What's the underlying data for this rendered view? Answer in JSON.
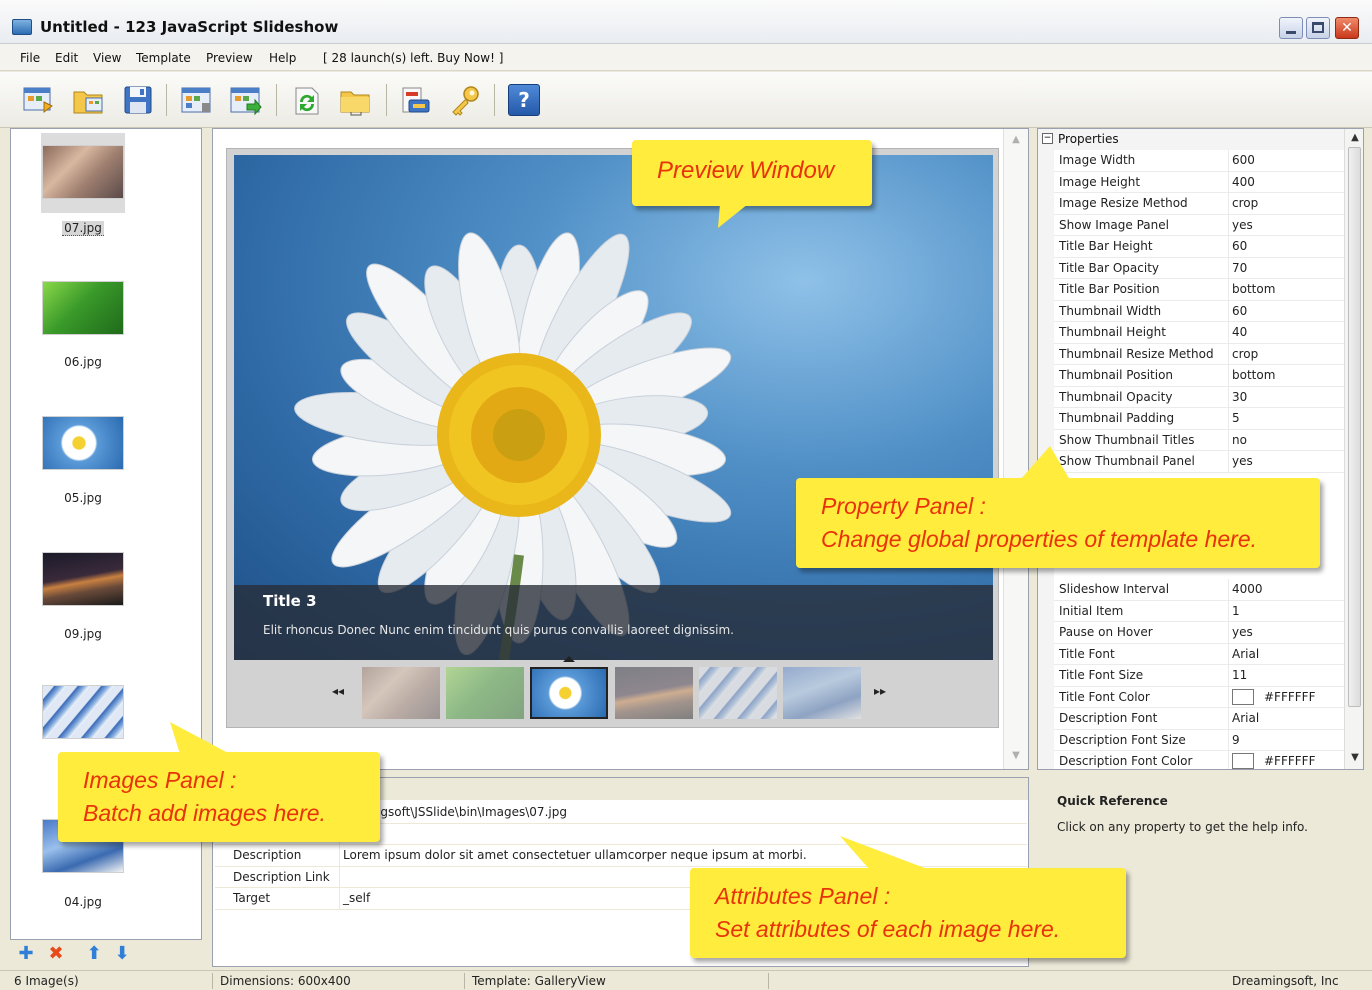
{
  "window": {
    "title": "Untitled - 123 JavaScript Slideshow",
    "minimize": "_",
    "maximize": "□",
    "close": "✕"
  },
  "menu": {
    "items": [
      "File",
      "Edit",
      "View",
      "Template",
      "Preview",
      "Help"
    ],
    "notice": "[ 28 launch(s) left. Buy Now! ]"
  },
  "toolbar": {
    "buttons": [
      "new-icon",
      "open-icon",
      "save-icon",
      "template-icon",
      "export-icon",
      "refresh-icon",
      "folder-icon",
      "publish-icon",
      "key-icon",
      "help-icon"
    ],
    "help_label": "?"
  },
  "images": {
    "items": [
      {
        "file": "07.jpg",
        "selected": true
      },
      {
        "file": "06.jpg",
        "selected": false
      },
      {
        "file": "05.jpg",
        "selected": false
      },
      {
        "file": "09.jpg",
        "selected": false
      },
      {
        "file": "04.jpg",
        "selected": false
      }
    ],
    "tools": [
      "add-icon",
      "delete-icon",
      "move-up-icon",
      "move-down-icon"
    ]
  },
  "preview": {
    "slide_title": "Title 3",
    "slide_description": "Elit rhoncus Donec Nunc enim tincidunt quis purus convallis laoreet dignissim.",
    "prev_label": "◂◂",
    "next_label": "▸▸"
  },
  "attributes": {
    "rows": [
      {
        "name": "",
        "value": "eamingsoft\\JSSlide\\bin\\Images\\07.jpg"
      },
      {
        "name": "",
        "value": ""
      },
      {
        "name": "Description",
        "value": "Lorem ipsum dolor sit amet consectetuer ullamcorper neque ipsum at morbi."
      },
      {
        "name": "Description Link",
        "value": ""
      },
      {
        "name": "Target",
        "value": "_self"
      }
    ]
  },
  "properties": {
    "header": "Properties",
    "rows": [
      {
        "name": "Image Width",
        "value": "600"
      },
      {
        "name": "Image Height",
        "value": "400"
      },
      {
        "name": "Image Resize Method",
        "value": "crop"
      },
      {
        "name": "Show Image Panel",
        "value": "yes"
      },
      {
        "name": "Title Bar Height",
        "value": "60"
      },
      {
        "name": "Title Bar Opacity",
        "value": "70"
      },
      {
        "name": "Title Bar Position",
        "value": "bottom"
      },
      {
        "name": "Thumbnail Width",
        "value": "60"
      },
      {
        "name": "Thumbnail Height",
        "value": "40"
      },
      {
        "name": "Thumbnail Resize Method",
        "value": "crop"
      },
      {
        "name": "Thumbnail Position",
        "value": "bottom"
      },
      {
        "name": "Thumbnail Opacity",
        "value": "30"
      },
      {
        "name": "Thumbnail Padding",
        "value": "5"
      },
      {
        "name": "Show Thumbnail Titles",
        "value": "no"
      },
      {
        "name": "Show Thumbnail Panel",
        "value": "yes"
      }
    ],
    "rows_lower": [
      {
        "name": "Slideshow Interval",
        "value": "4000"
      },
      {
        "name": "Initial Item",
        "value": "1"
      },
      {
        "name": "Pause on Hover",
        "value": "yes"
      },
      {
        "name": "Title Font",
        "value": "Arial"
      },
      {
        "name": "Title Font Size",
        "value": "11"
      },
      {
        "name": "Title Font Color",
        "value": "#FFFFFF",
        "swatch": "#FFFFFF"
      },
      {
        "name": "Description Font",
        "value": "Arial"
      },
      {
        "name": "Description Font Size",
        "value": "9"
      },
      {
        "name": "Description Font Color",
        "value": "#FFFFFF",
        "swatch": "#FFFFFF"
      }
    ]
  },
  "quick_reference": {
    "title": "Quick Reference",
    "body": "Click on any property to get the help info."
  },
  "status": {
    "count": "6 Image(s)",
    "dimensions": "Dimensions: 600x400",
    "template": "Template: GalleryView",
    "company": "Dreamingsoft, Inc"
  },
  "callouts": {
    "preview": "Preview Window",
    "property_line1": "Property Panel :",
    "property_line2": "Change  global properties of template here.",
    "images_line1": "Images Panel :",
    "images_line2": "Batch add images here.",
    "attributes_line1": "Attributes Panel :",
    "attributes_line2": "Set attributes of each image here."
  },
  "colors": {
    "callout_bg": "#ffec3d",
    "callout_text": "#e8320a",
    "window_bg": "#ece9d8"
  }
}
